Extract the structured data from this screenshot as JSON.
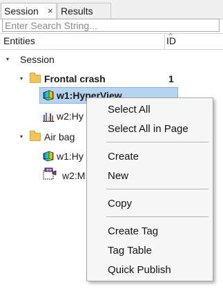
{
  "tabs": [
    {
      "label": "Session",
      "close": "×"
    },
    {
      "label": "Results"
    }
  ],
  "search": {
    "placeholder": "Enter Search String..."
  },
  "columns": {
    "entities": "Entities",
    "id": "ID"
  },
  "tree": {
    "root": {
      "label": "Session"
    },
    "groups": [
      {
        "label": "Frontal crash",
        "id": "1",
        "children": [
          {
            "label": "w1:HyperView",
            "icon": "hyperview-icon",
            "selected": true
          },
          {
            "label": "w2:Hy",
            "icon": "hypergraph-icon"
          }
        ]
      },
      {
        "label": "Air bag",
        "children": [
          {
            "label": "w1:Hy",
            "icon": "hyperview-icon"
          },
          {
            "label": "w2:M",
            "icon": "mediaview-icon"
          }
        ]
      }
    ]
  },
  "context_menu": {
    "items": [
      {
        "label": "Select All"
      },
      {
        "label": "Select All in Page"
      },
      {
        "label": "Create"
      },
      {
        "label": "New"
      },
      {
        "label": "Copy"
      },
      {
        "label": "Create Tag"
      },
      {
        "label": "Tag Table"
      },
      {
        "label": "Quick Publish"
      }
    ]
  },
  "colors": {
    "selection_bg": "#b7d4ee",
    "folder": "#f2c55c",
    "menu_bg": "#f7f7f7"
  }
}
